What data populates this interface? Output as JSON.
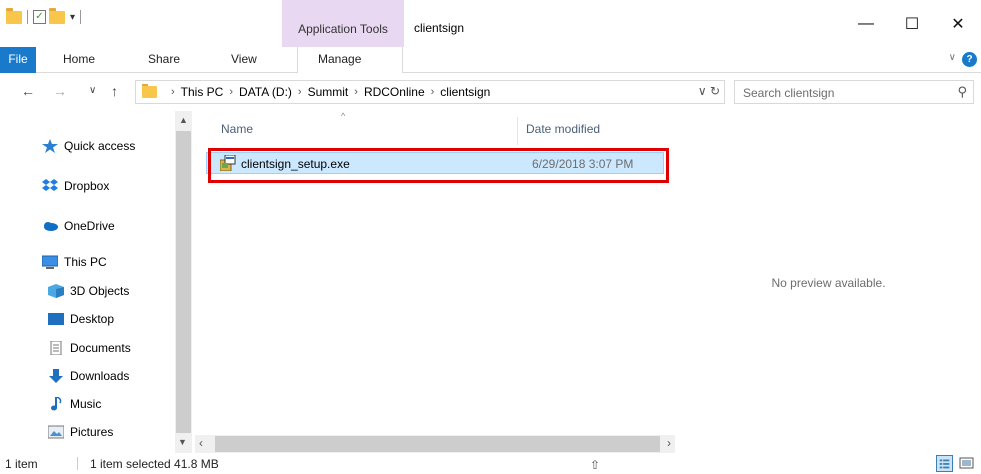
{
  "window": {
    "context_tab": "Application Tools",
    "title": "clientsign",
    "minimize_glyph": "—",
    "maximize_glyph": "☐",
    "close_glyph": "✕"
  },
  "ribbon": {
    "tabs": [
      "File",
      "Home",
      "Share",
      "View",
      "Manage"
    ],
    "help_glyph": "?",
    "expand_glyph": "∨"
  },
  "nav": {
    "back": "←",
    "forward": "→",
    "recent": "∨",
    "up": "↑",
    "breadcrumbs": [
      "This PC",
      "DATA (D:)",
      "Summit",
      "RDCOnline",
      "clientsign"
    ],
    "breadcrumb_separator": "›",
    "refresh_glyph": "∨ ↻",
    "search_placeholder": "Search clientsign",
    "search_glyph": "⚲"
  },
  "sidebar": {
    "items": [
      {
        "label": "Quick access",
        "icon": "star-icon"
      },
      {
        "label": "Dropbox",
        "icon": "dropbox-icon"
      },
      {
        "label": "OneDrive",
        "icon": "onedrive-icon"
      },
      {
        "label": "This PC",
        "icon": "computer-icon"
      },
      {
        "label": "3D Objects",
        "icon": "cube-icon"
      },
      {
        "label": "Desktop",
        "icon": "desktop-icon"
      },
      {
        "label": "Documents",
        "icon": "documents-icon"
      },
      {
        "label": "Downloads",
        "icon": "download-icon"
      },
      {
        "label": "Music",
        "icon": "music-icon"
      },
      {
        "label": "Pictures",
        "icon": "pictures-icon"
      }
    ]
  },
  "list": {
    "columns": [
      "Name",
      "Date modified"
    ],
    "sort_caret": "^",
    "rows": [
      {
        "name": "clientsign_setup.exe",
        "date": "6/29/2018 3:07 PM",
        "selected": true
      }
    ]
  },
  "preview": {
    "message": "No preview available."
  },
  "status": {
    "item_count": "1 item",
    "selection": "1 item selected  41.8 MB"
  },
  "colors": {
    "file_tab": "#1979ca",
    "selection_bg": "#cce8ff",
    "highlight_border": "#e00000",
    "context_tab_bg": "#e9d8f2"
  }
}
